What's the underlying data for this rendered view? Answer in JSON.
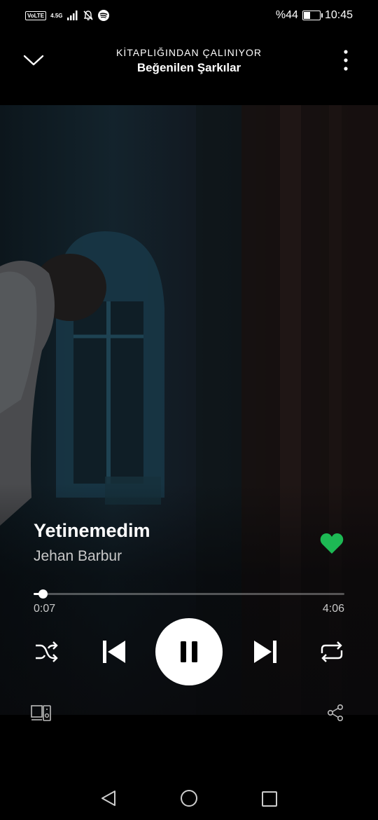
{
  "status_bar": {
    "volte": "VoLTE",
    "network": "4.5G",
    "battery_label": "%44",
    "battery_level": 0.44,
    "time": "10:45"
  },
  "header": {
    "context": "KİTAPLIĞINDAN ÇALINIYOR",
    "playlist": "Beğenilen Şarkılar"
  },
  "track": {
    "title": "Yetinemedim",
    "artist": "Jehan Barbur",
    "liked": true
  },
  "playback": {
    "elapsed": "0:07",
    "duration": "4:06",
    "progress": 0.03
  },
  "colors": {
    "accent": "#1DB954",
    "background": "#000000",
    "secondary_text": "#c8c8c8"
  },
  "icons": {
    "minimize": "chevron-down-icon",
    "more": "more-vertical-icon",
    "like": "heart-icon",
    "shuffle": "shuffle-icon",
    "previous": "skip-previous-icon",
    "play_pause": "pause-icon",
    "next": "skip-next-icon",
    "repeat": "repeat-icon",
    "devices": "devices-icon",
    "share": "share-icon"
  }
}
